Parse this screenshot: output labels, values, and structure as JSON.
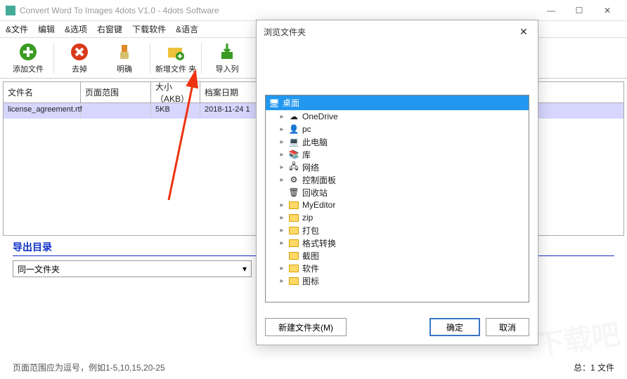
{
  "window": {
    "title": "Convert Word To Images 4dots V1.0 - 4dots Software"
  },
  "menu": {
    "items": [
      "&文件",
      "编辑",
      "&选项",
      "右窗键",
      "下载软件",
      "&语言"
    ]
  },
  "toolbar": {
    "add": "添加文件",
    "remove": "去掉",
    "confirm": "明确",
    "addfolder": "新增文件 夹",
    "import": "导入列"
  },
  "table": {
    "headers": {
      "name": "文件名",
      "range": "页面范围",
      "size": "大小（AKB）",
      "date": "档案日期"
    },
    "rows": [
      {
        "name": "license_agreement.rtf",
        "range": "",
        "size": "5KB",
        "date": "2018-11-24 1"
      }
    ]
  },
  "export": {
    "title": "导出目录",
    "combo_value": "同一文件夹"
  },
  "footer": {
    "hint": "页面范围应为逗号，例如1-5,10,15,20-25",
    "total": "总：1 文件"
  },
  "dialog": {
    "title": "浏览文件夹",
    "tree": [
      {
        "label": "桌面",
        "root": true,
        "icon": "desktop"
      },
      {
        "label": "OneDrive",
        "exp": true,
        "icon": "cloud"
      },
      {
        "label": "pc",
        "exp": true,
        "icon": "user"
      },
      {
        "label": "此电脑",
        "exp": true,
        "icon": "pc"
      },
      {
        "label": "库",
        "exp": true,
        "icon": "lib"
      },
      {
        "label": "网络",
        "exp": true,
        "icon": "net"
      },
      {
        "label": "控制面板",
        "exp": true,
        "icon": "cpl"
      },
      {
        "label": "回收站",
        "exp": false,
        "icon": "bin"
      },
      {
        "label": "MyEditor",
        "exp": true,
        "icon": "folder"
      },
      {
        "label": "zip",
        "exp": true,
        "icon": "folder"
      },
      {
        "label": "打包",
        "exp": true,
        "icon": "folder"
      },
      {
        "label": "格式转换",
        "exp": true,
        "icon": "folder"
      },
      {
        "label": "截图",
        "exp": false,
        "icon": "folder"
      },
      {
        "label": "软件",
        "exp": true,
        "icon": "folder"
      },
      {
        "label": "图标",
        "exp": true,
        "icon": "folder"
      }
    ],
    "buttons": {
      "newfolder": "新建文件夹(M)",
      "ok": "确定",
      "cancel": "取消"
    }
  },
  "watermark": "下载吧"
}
